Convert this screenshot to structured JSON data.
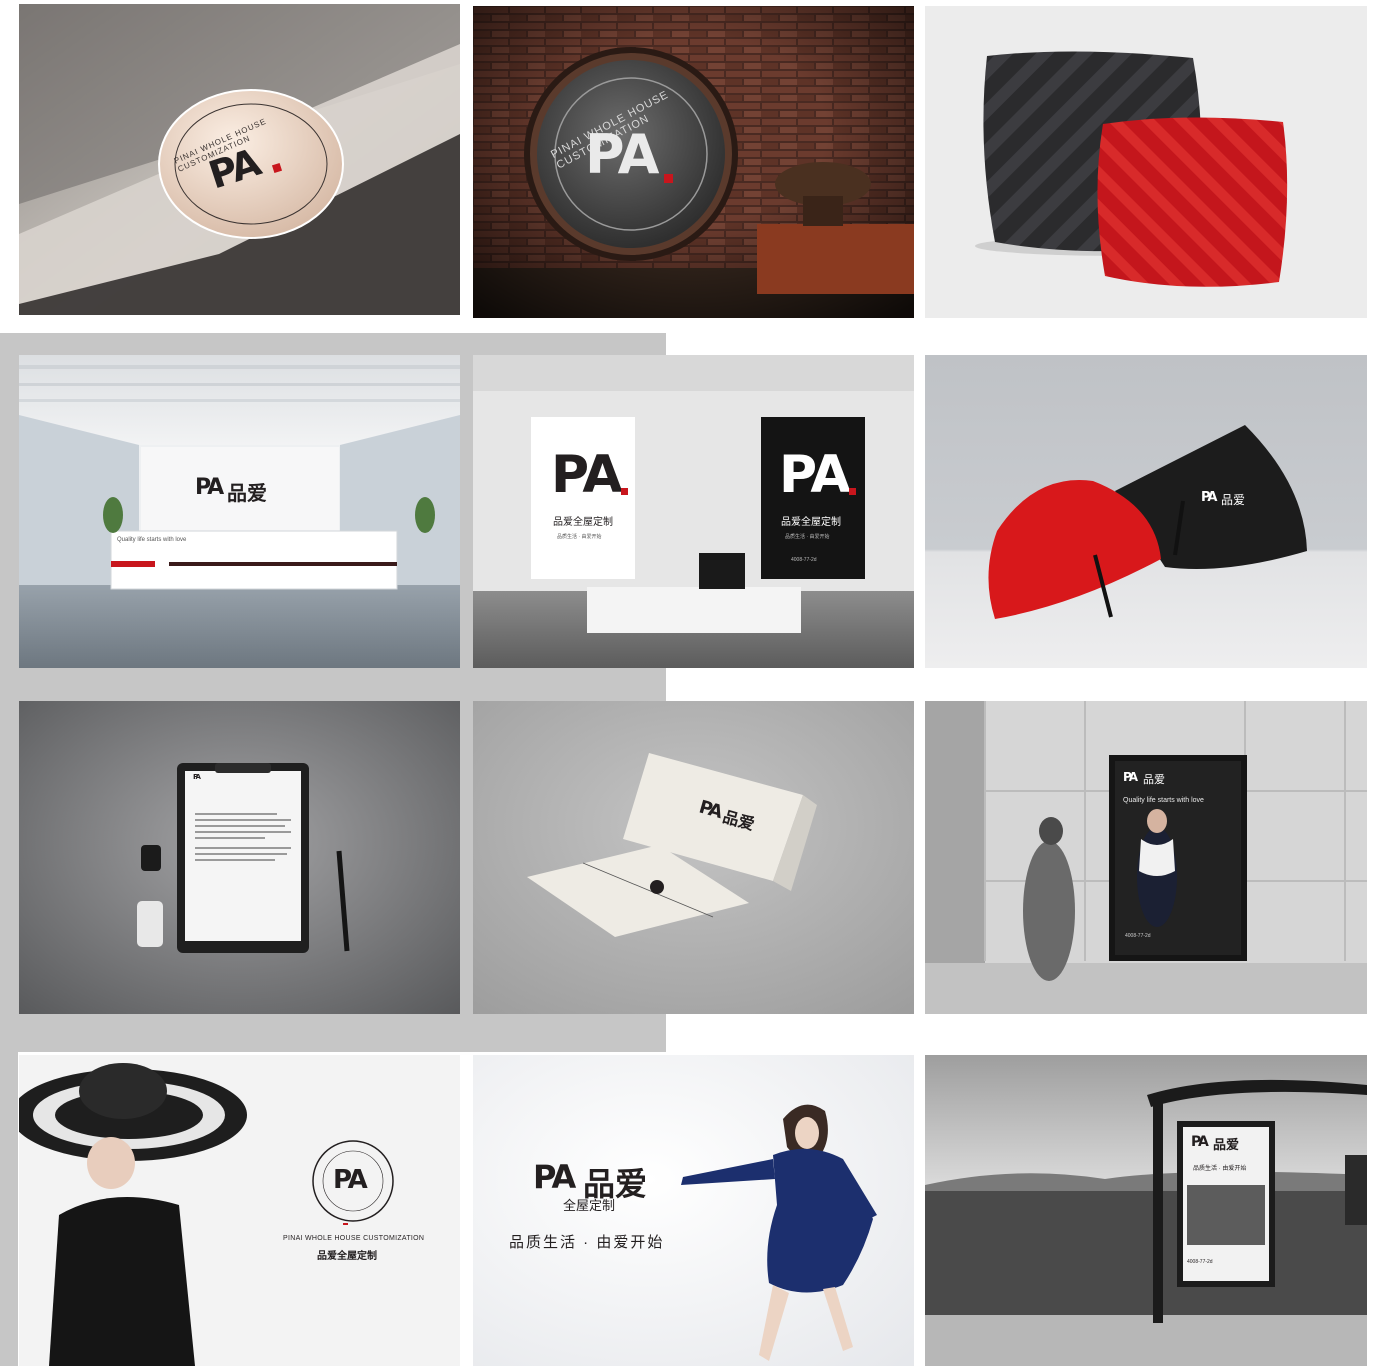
{
  "brand": {
    "mark": "PA",
    "name_cn": "品爱",
    "full_cn": "品爱全屋定制",
    "sub_cn": "全屋定制",
    "slogan_cn": "品质生活 · 由爱开始",
    "slogan_short_cn": "品质生活 · 由爱开始",
    "ring_text": "PINAI WHOLE HOUSE CUSTOMIZATION",
    "tagline_en": "Quality life starts with love",
    "phone": "4008-77-2d",
    "red": "#c8161d",
    "dark": "#231f20"
  },
  "tiles": [
    {
      "id": "paper-sticker",
      "subject": "round sticker on paper"
    },
    {
      "id": "brick-wall-sign",
      "subject": "metal sign on brick wall"
    },
    {
      "id": "cushions",
      "subject": "black and red cushions"
    },
    {
      "id": "reception",
      "subject": "office reception wall"
    },
    {
      "id": "office-posters",
      "subject": "office wall posters"
    },
    {
      "id": "umbrellas",
      "subject": "black and red umbrellas"
    },
    {
      "id": "clipboard",
      "subject": "letterhead on clipboard"
    },
    {
      "id": "business-cards",
      "subject": "business cards"
    },
    {
      "id": "street-poster",
      "subject": "street wall poster"
    },
    {
      "id": "hat-ad",
      "subject": "woman with hat advertisement"
    },
    {
      "id": "dress-ad",
      "subject": "woman in blue dress advertisement"
    },
    {
      "id": "bus-shelter",
      "subject": "bus shelter billboard"
    }
  ]
}
